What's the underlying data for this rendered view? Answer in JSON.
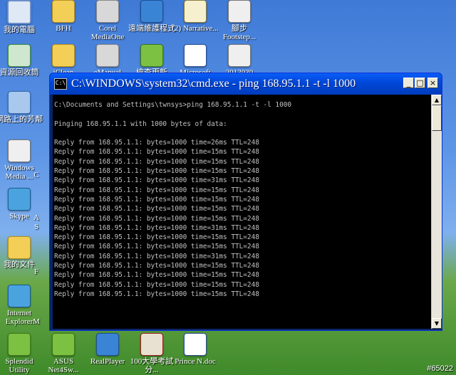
{
  "desktop": {
    "icons": [
      {
        "label": "我的電腦",
        "icon": "computer-icon"
      },
      {
        "label": "BFH",
        "icon": "folder-icon"
      },
      {
        "label": "Corel MediaOne",
        "icon": "app-icon"
      },
      {
        "label": "遠端維護程式",
        "icon": "remote-icon"
      },
      {
        "label": "(2) Narrative...",
        "icon": "document-icon"
      },
      {
        "label": "腳步 Footstep...",
        "icon": "media-icon"
      },
      {
        "label": "資源回收筒",
        "icon": "recycle-bin-icon"
      },
      {
        "label": "iClean",
        "icon": "folder-icon"
      },
      {
        "label": "eManual",
        "icon": "app-icon"
      },
      {
        "label": "檢查更新",
        "icon": "update-icon"
      },
      {
        "label": "Microsoft",
        "icon": "word-icon"
      },
      {
        "label": "2012030",
        "icon": "media-icon"
      },
      {
        "label": "網路上的芳鄰",
        "icon": "network-icon"
      },
      {
        "label": "Windows Media ...",
        "icon": "media-player-icon"
      },
      {
        "label": "Skype",
        "icon": "skype-icon"
      },
      {
        "label": "我的文件",
        "icon": "my-documents-icon"
      },
      {
        "label": "Internet Explorer",
        "icon": "ie-icon"
      },
      {
        "label": "Splendid Utility",
        "icon": "splendid-icon"
      },
      {
        "label": "ASUS Net4Sw...",
        "icon": "asus-icon"
      },
      {
        "label": "RealPlayer",
        "icon": "realplayer-icon"
      },
      {
        "label": "100大學考試分...",
        "icon": "document-icon"
      },
      {
        "label": "Prince N.doc",
        "icon": "word-icon"
      }
    ],
    "partial_labels": [
      "C",
      "A",
      "S",
      "F",
      "M"
    ],
    "badge": "#65022"
  },
  "window": {
    "title": "C:\\WINDOWS\\system32\\cmd.exe - ping 168.95.1.1 -t -l 1000",
    "icon_text": "C:\\",
    "buttons": {
      "minimize": "_",
      "maximize": "□",
      "close": "×"
    },
    "console_lines": [
      "C:\\Documents and Settings\\twnsys>ping 168.95.1.1 -t -l 1000",
      "",
      "Pinging 168.95.1.1 with 1000 bytes of data:",
      "",
      "Reply from 168.95.1.1: bytes=1000 time=26ms TTL=248",
      "Reply from 168.95.1.1: bytes=1000 time=15ms TTL=248",
      "Reply from 168.95.1.1: bytes=1000 time=15ms TTL=248",
      "Reply from 168.95.1.1: bytes=1000 time=15ms TTL=248",
      "Reply from 168.95.1.1: bytes=1000 time=31ms TTL=248",
      "Reply from 168.95.1.1: bytes=1000 time=15ms TTL=248",
      "Reply from 168.95.1.1: bytes=1000 time=15ms TTL=248",
      "Reply from 168.95.1.1: bytes=1000 time=15ms TTL=248",
      "Reply from 168.95.1.1: bytes=1000 time=15ms TTL=248",
      "Reply from 168.95.1.1: bytes=1000 time=31ms TTL=248",
      "Reply from 168.95.1.1: bytes=1000 time=15ms TTL=248",
      "Reply from 168.95.1.1: bytes=1000 time=15ms TTL=248",
      "Reply from 168.95.1.1: bytes=1000 time=31ms TTL=248",
      "Reply from 168.95.1.1: bytes=1000 time=15ms TTL=248",
      "Reply from 168.95.1.1: bytes=1000 time=15ms TTL=248",
      "Reply from 168.95.1.1: bytes=1000 time=15ms TTL=248",
      "Reply from 168.95.1.1: bytes=1000 time=15ms TTL=248"
    ],
    "scrollbar": {
      "up": "▲",
      "down": "▼"
    }
  }
}
